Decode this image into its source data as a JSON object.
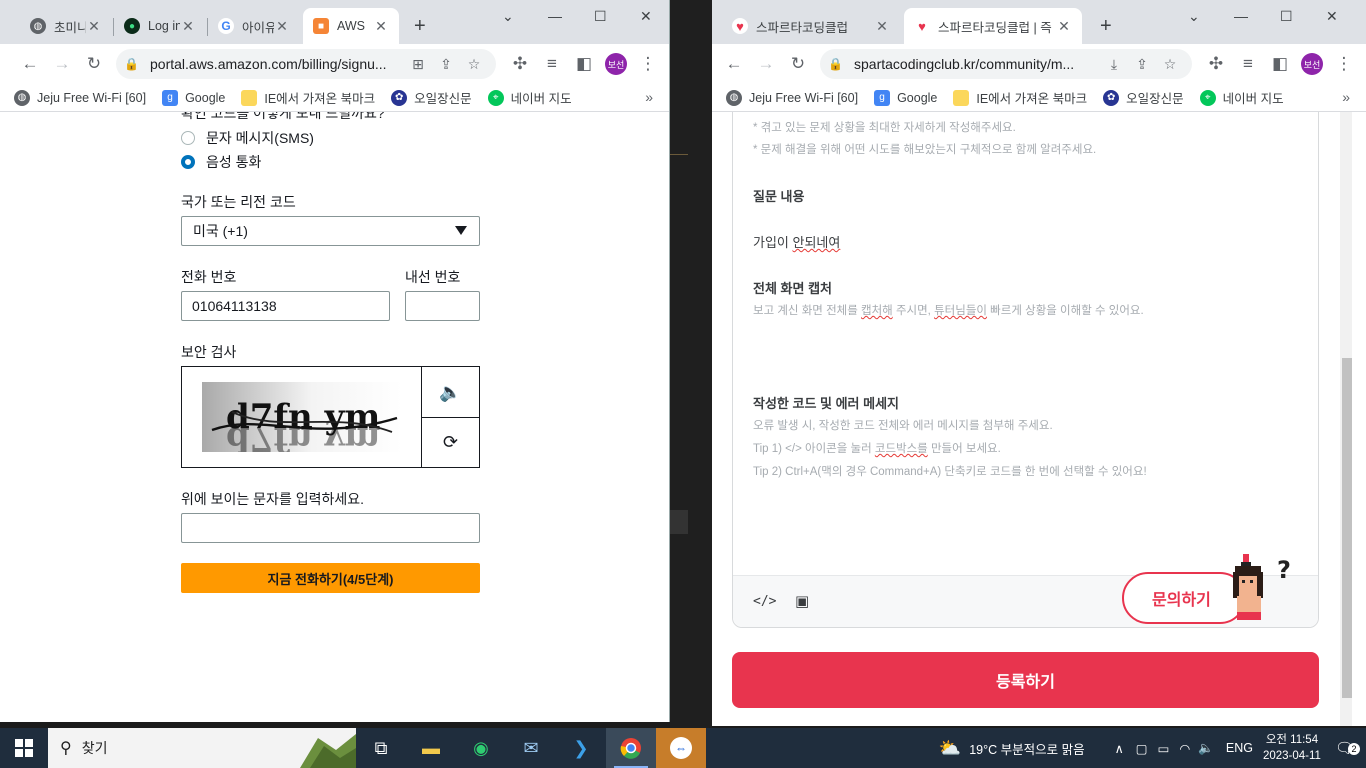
{
  "left_browser": {
    "tabs": [
      {
        "title": "초미니",
        "icon": "globe-icon"
      },
      {
        "title": "Log in",
        "icon": "leaf-icon"
      },
      {
        "title": "아이유",
        "icon": "google-icon"
      },
      {
        "title": "AWS",
        "icon": "aws-cube-icon"
      }
    ],
    "url": "portal.aws.amazon.com/billing/signu...",
    "profile": "보선"
  },
  "right_browser": {
    "tabs": [
      {
        "title": "스파르타코딩클럽",
        "icon": "sparta-heart-icon"
      },
      {
        "title": "스파르타코딩클럽 | 즉",
        "icon": "sparta-heart-icon"
      }
    ],
    "url": "spartacodingclub.kr/community/m...",
    "profile": "보선"
  },
  "bookmarks": [
    {
      "label": "Jeju Free Wi-Fi [60]",
      "icon": "globe-icon"
    },
    {
      "label": "Google",
      "icon": "google-icon"
    },
    {
      "label": "IE에서 가져온 북마크",
      "icon": "folder-icon"
    },
    {
      "label": "오일장신문",
      "icon": "oil-market-icon"
    },
    {
      "label": "네이버 지도",
      "icon": "naver-map-icon"
    }
  ],
  "aws_form": {
    "partial_label": "확인 코드를 어떻게 보내 드릴까요?",
    "radio_sms": "문자 메시지(SMS)",
    "radio_voice": "음성 통화",
    "country_label": "국가 또는 리전 코드",
    "country_value": "미국 (+1)",
    "phone_label": "전화 번호",
    "phone_value": "01064113138",
    "ext_label": "내선 번호",
    "ext_value": "",
    "security_label": "보안 검사",
    "captcha_text": "d7fn ym",
    "captcha_input_label": "위에 보이는 문자를 입력하세요.",
    "captcha_input_value": "",
    "submit": "지금 전화하기(4/5단계)"
  },
  "sparta": {
    "hint1": "* 겪고 있는 문제 상황을 최대한 자세하게 작성해주세요.",
    "hint2": "* 문제 해결을 위해 어떤 시도를 해보았는지 구체적으로 함께 알려주세요.",
    "q_heading": "질문 내용",
    "q_text_a": "가입이 ",
    "q_text_b": "안되네여",
    "capture_heading": "전체 화면 캡처",
    "capture_hint_a": "보고 계신 화면 전체를 ",
    "capture_hint_b": "캡처해",
    "capture_hint_c": " 주시면, ",
    "capture_hint_d": "튜터님들이",
    "capture_hint_e": " 빠르게 상황을 이해할 수 있어요.",
    "code_heading": "작성한 코드 및 에러 메세지",
    "code_hint1": "오류 발생 시, 작성한 코드 전체와 에러 메시지를 첨부해 주세요.",
    "code_hint2a": "Tip 1) </> 아이콘을 눌러 ",
    "code_hint2b": "코드박스를",
    "code_hint2c": " 만들어 보세요.",
    "code_hint3": "Tip 2) Ctrl+A(맥의 경우 Command+A) 단축키로 코드를 한 번에 선택할 수 있어요!",
    "ask_button": "문의하기",
    "register_button": "등록하기"
  },
  "taskbar": {
    "search_placeholder": "찾기",
    "weather": "19°C  부분적으로 맑음",
    "lang": "ENG",
    "time": "오전 11:54",
    "date": "2023-04-11",
    "notifications": "2"
  },
  "colors": {
    "aws_orange": "#ff9900",
    "aws_blue": "#0073bb",
    "sparta_red": "#e8344e",
    "taskbar": "#1f2d3d"
  }
}
